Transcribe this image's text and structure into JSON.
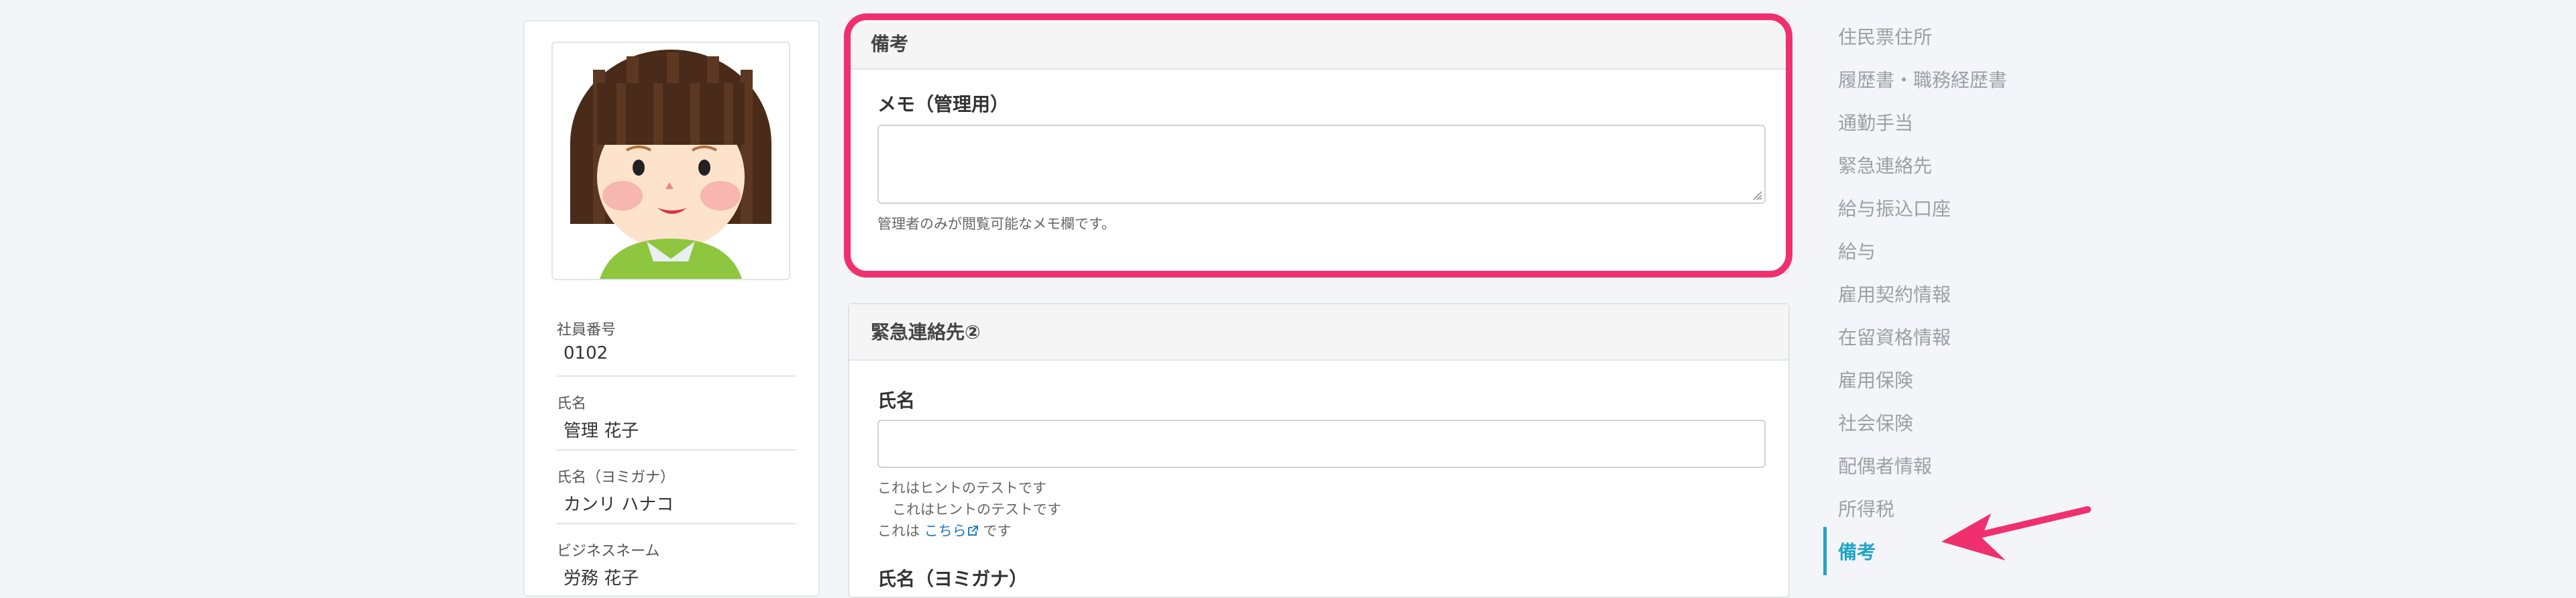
{
  "profile": {
    "fields": [
      {
        "label": "社員番号",
        "value": "0102"
      },
      {
        "label": "氏名",
        "value": "管理 花子"
      },
      {
        "label": "氏名（ヨミガナ）",
        "value": "カンリ ハナコ"
      },
      {
        "label": "ビジネスネーム",
        "value": "労務 花子"
      }
    ]
  },
  "remarks_panel": {
    "title": "備考",
    "memo_label": "メモ（管理用）",
    "memo_value": "",
    "memo_hint": "管理者のみが閲覧可能なメモ欄です。"
  },
  "emergency_panel": {
    "title": "緊急連絡先②",
    "name_label": "氏名",
    "name_value": "",
    "hint_line1": "これはヒントのテストです",
    "hint_line2": "これはヒントのテストです",
    "hint_line3_pre": "これは",
    "hint_line3_link": "こちら",
    "hint_line3_post": "です",
    "reading_label": "氏名（ヨミガナ）"
  },
  "sidenav": {
    "items": [
      {
        "label": "住民票住所"
      },
      {
        "label": "履歴書・職務経歴書"
      },
      {
        "label": "通勤手当"
      },
      {
        "label": "緊急連絡先"
      },
      {
        "label": "給与振込口座"
      },
      {
        "label": "給与"
      },
      {
        "label": "雇用契約情報"
      },
      {
        "label": "在留資格情報"
      },
      {
        "label": "雇用保険"
      },
      {
        "label": "社会保険"
      },
      {
        "label": "配偶者情報"
      },
      {
        "label": "所得税"
      },
      {
        "label": "備考",
        "active": true
      }
    ]
  },
  "colors": {
    "highlight": "#f0306e",
    "active_nav": "#22a4c4",
    "link": "#1a7fc1"
  }
}
